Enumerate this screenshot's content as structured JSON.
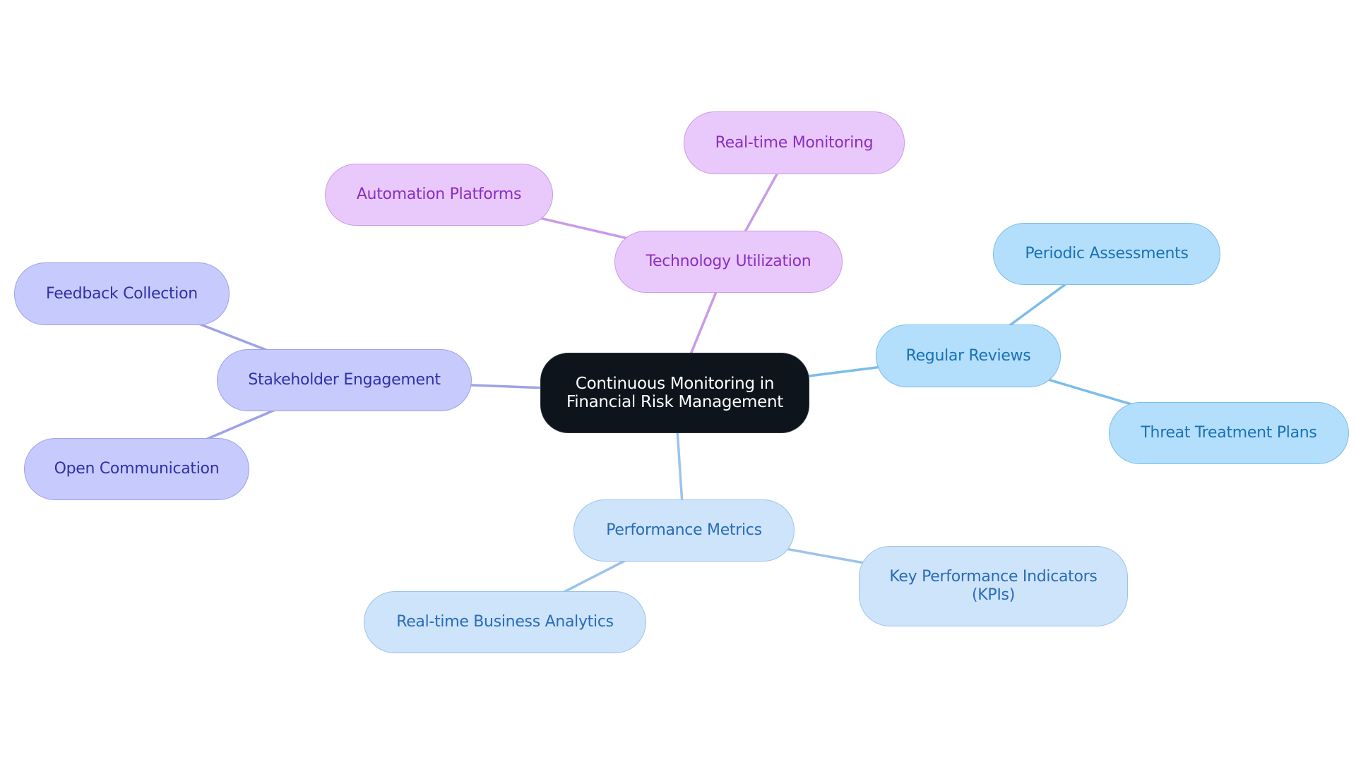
{
  "diagram": {
    "type": "mindmap",
    "root": {
      "id": "root",
      "label": "Continuous Monitoring in Financial Risk Management",
      "lines": [
        "Continuous Monitoring in",
        "Financial Risk Management"
      ]
    },
    "branches": [
      {
        "id": "tech",
        "label": "Technology Utilization",
        "color": "#c99be6",
        "children": [
          {
            "id": "rtm",
            "label": "Real-time Monitoring"
          },
          {
            "id": "auto",
            "label": "Automation Platforms"
          }
        ]
      },
      {
        "id": "reviews",
        "label": "Regular Reviews",
        "color": "#7cbdea",
        "children": [
          {
            "id": "periodic",
            "label": "Periodic Assessments"
          },
          {
            "id": "threat",
            "label": "Threat Treatment Plans"
          }
        ]
      },
      {
        "id": "metrics",
        "label": "Performance Metrics",
        "color": "#9cc3ea",
        "children": [
          {
            "id": "kpi",
            "label": "Key Performance Indicators (KPIs)",
            "lines": [
              "Key Performance Indicators",
              "(KPIs)"
            ]
          },
          {
            "id": "rtba",
            "label": "Real-time Business Analytics"
          }
        ]
      },
      {
        "id": "stake",
        "label": "Stakeholder Engagement",
        "color": "#9ea2e8",
        "children": [
          {
            "id": "feedback",
            "label": "Feedback Collection"
          },
          {
            "id": "opencomm",
            "label": "Open Communication"
          }
        ]
      }
    ]
  }
}
